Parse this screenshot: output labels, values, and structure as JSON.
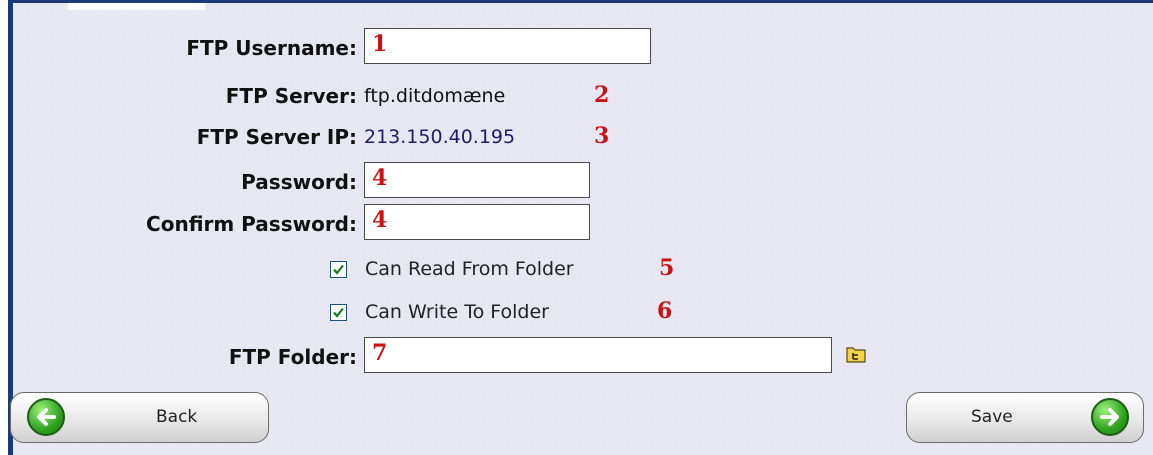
{
  "form": {
    "username_label": "FTP Username:",
    "username_marker": "1",
    "server_label": "FTP Server:",
    "server_value": "ftp.ditdomæne",
    "server_marker": "2",
    "ip_label": "FTP Server IP:",
    "ip_value": "213.150.40.195",
    "ip_marker": "3",
    "password_label": "Password:",
    "password_marker": "4",
    "confirm_label": "Confirm Password:",
    "confirm_marker": "4",
    "can_read_label": "Can Read From Folder",
    "can_read_checked": true,
    "can_read_marker": "5",
    "can_write_label": "Can Write To Folder",
    "can_write_checked": true,
    "can_write_marker": "6",
    "folder_label": "FTP Folder:",
    "folder_marker": "7"
  },
  "buttons": {
    "back_label": "Back",
    "save_label": "Save"
  },
  "icons": {
    "browse": "folder-tree-icon",
    "back": "arrow-left-icon",
    "save": "arrow-right-icon"
  },
  "colors": {
    "border": "#1b3a78",
    "marker": "#cc1111",
    "ip_text": "#1d1d6b",
    "arrow_green": "#2fa31f"
  }
}
